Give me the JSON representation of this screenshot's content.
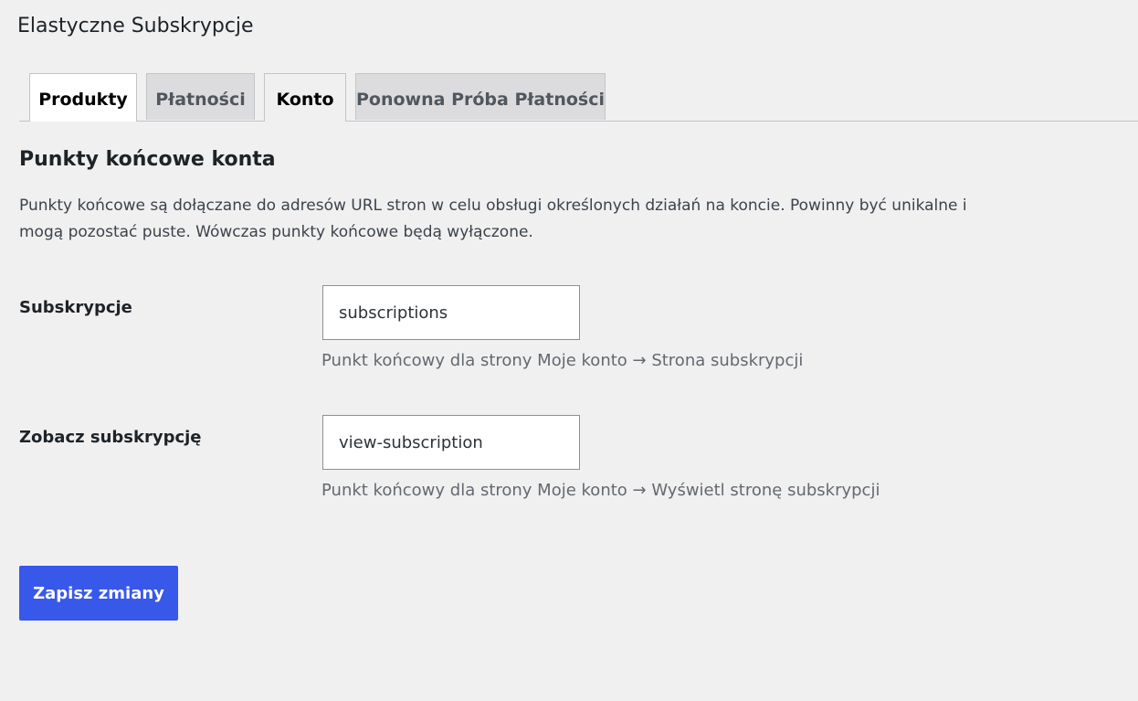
{
  "header": {
    "title": "Elastyczne Subskrypcje"
  },
  "tabs": [
    {
      "label": "Produkty",
      "active": false
    },
    {
      "label": "Płatności",
      "active": false
    },
    {
      "label": "Konto",
      "active": true
    },
    {
      "label": "Ponowna Próba Płatności",
      "active": false
    }
  ],
  "section": {
    "title": "Punkty końcowe konta",
    "description": "Punkty końcowe są dołączane do adresów URL stron w celu obsługi określonych działań na koncie. Powinny być unikalne i mogą pozostać puste. Wówczas punkty końcowe będą wyłączone."
  },
  "fields": [
    {
      "label": "Subskrypcje",
      "value": "subscriptions",
      "hint": "Punkt końcowy dla strony Moje konto → Strona subskrypcji"
    },
    {
      "label": "Zobacz subskrypcję",
      "value": "view-subscription",
      "hint": "Punkt końcowy dla strony Moje konto → Wyświetl stronę subskrypcji"
    }
  ],
  "actions": {
    "save_label": "Zapisz zmiany"
  },
  "colors": {
    "background": "#f0f0f1",
    "primary_button": "#3858e9",
    "inactive_tab": "#dcdcde",
    "active_tab": "#ffffff"
  }
}
